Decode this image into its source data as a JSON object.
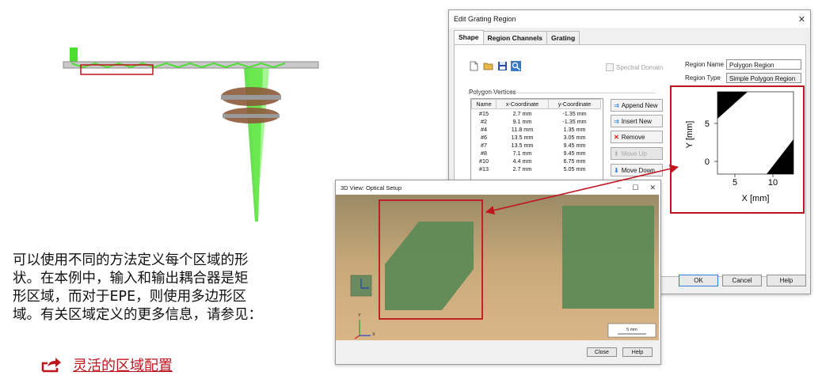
{
  "edit_dialog": {
    "title": "Edit Grating Region",
    "tabs": [
      "Shape",
      "Region Channels",
      "Grating"
    ],
    "spectral_domain_label": "Spectral Domain",
    "region_name_label": "Region Name",
    "region_name_value": "Polygon Region",
    "region_type_label": "Region Type",
    "region_type_value": "Simple Polygon Region",
    "polygon_vertices_label": "Polygon Vertices",
    "table_headers": [
      "Name",
      "x-Coordinate",
      "y-Coordinate"
    ],
    "table_rows": [
      [
        "#15",
        "2.7 mm",
        "-1.35 mm"
      ],
      [
        "#2",
        "9.1 mm",
        "-1.35 mm"
      ],
      [
        "#4",
        "11.8 mm",
        "1.35 mm"
      ],
      [
        "#6",
        "13.5 mm",
        "3.05 mm"
      ],
      [
        "#7",
        "13.5 mm",
        "9.45 mm"
      ],
      [
        "#8",
        "7.1 mm",
        "9.45 mm"
      ],
      [
        "#10",
        "4.4 mm",
        "6.75 mm"
      ],
      [
        "#13",
        "2.7 mm",
        "5.05 mm"
      ]
    ],
    "buttons": {
      "append": "Append New",
      "insert": "Insert New",
      "remove": "Remove",
      "move_up": "Move Up",
      "move_down": "Move Down",
      "ok": "OK",
      "cancel": "Cancel",
      "help": "Help"
    },
    "plot": {
      "ylabel": "Y [mm]",
      "xlabel": "X [mm]",
      "xticks": [
        "5",
        "10"
      ],
      "yticks": [
        "0",
        "5"
      ]
    }
  },
  "view3d": {
    "title": "3D View: Optical Setup",
    "scale_label": "5 mm",
    "buttons": {
      "close": "Close",
      "help": "Help"
    },
    "axis_labels": {
      "y": "Y",
      "x": "X"
    }
  },
  "description": {
    "lines": [
      "可以使用不同的方法定义每个区域的形",
      "状。在本例中，输入和输出耦合器是矩",
      "形区域，而对于EPE，则使用多边形区",
      "域。有关区域定义的更多信息，请参见："
    ],
    "link_text": "灵活的区域配置"
  },
  "colors": {
    "highlight": "#c0141e",
    "grating_green": "#5e8a56",
    "beam_green": "#4ddd33"
  }
}
